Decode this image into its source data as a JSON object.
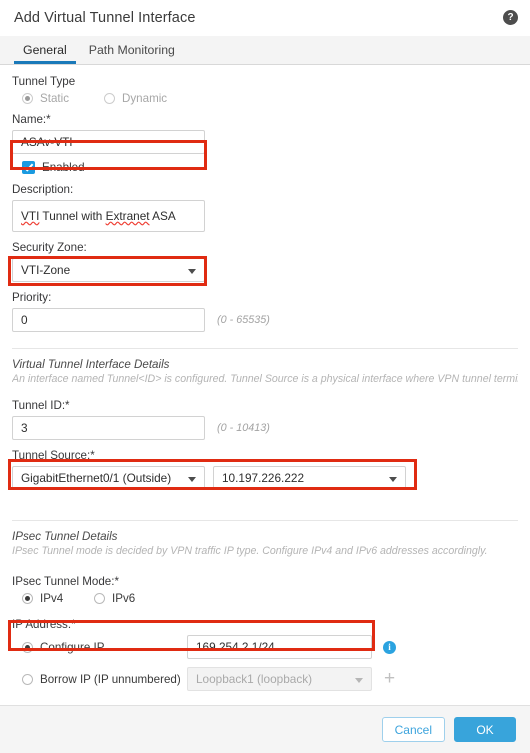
{
  "header": {
    "title": "Add Virtual Tunnel Interface",
    "help_icon": "help-icon"
  },
  "tabs": [
    {
      "label": "General",
      "active": true
    },
    {
      "label": "Path Monitoring",
      "active": false
    }
  ],
  "form": {
    "tunnel_type": {
      "label": "Tunnel Type",
      "options": [
        {
          "label": "Static",
          "selected": true,
          "disabled": true
        },
        {
          "label": "Dynamic",
          "selected": false,
          "disabled": true
        }
      ]
    },
    "name": {
      "label": "Name:*",
      "value": "ASAv-VTI",
      "highlighted": true
    },
    "enabled": {
      "label": "Enabled",
      "checked": true
    },
    "description": {
      "label": "Description:",
      "value_part1": "VTI",
      "value_part2": " Tunnel with ",
      "value_part3": "Extranet",
      "value_part4": " ASA",
      "value": "VTI Tunnel with Extranet ASA"
    },
    "security_zone": {
      "label": "Security Zone:",
      "value": "VTI-Zone",
      "highlighted": true
    },
    "priority": {
      "label": "Priority:",
      "value": "0",
      "hint": "(0 - 65535)"
    }
  },
  "vti_section": {
    "title": "Virtual Tunnel Interface Details",
    "description": "An interface named Tunnel<ID> is configured. Tunnel Source is a physical interface where VPN tunnel terminates for the VTI.",
    "tunnel_id": {
      "label": "Tunnel ID:*",
      "value": "3",
      "hint": "(0 - 10413)"
    },
    "tunnel_source": {
      "label": "Tunnel Source:*",
      "interface": "GigabitEthernet0/1 (Outside)",
      "address": "10.197.226.222",
      "highlighted": true
    }
  },
  "ipsec_section": {
    "title": "IPsec Tunnel Details",
    "description": "IPsec Tunnel mode is decided by VPN traffic IP type. Configure IPv4 and IPv6 addresses accordingly.",
    "tunnel_mode": {
      "label": "IPsec Tunnel Mode:*",
      "options": [
        {
          "label": "IPv4",
          "selected": true
        },
        {
          "label": "IPv6",
          "selected": false
        }
      ]
    },
    "ip_address": {
      "label": "IP Address:*",
      "configure_ip": {
        "label": "Configure IP",
        "selected": true,
        "value": "169.254.2.1/24",
        "highlighted": true,
        "info_icon": "info-icon"
      },
      "borrow_ip": {
        "label": "Borrow IP (IP unnumbered)",
        "selected": false,
        "value": "Loopback1 (loopback)",
        "disabled": true,
        "add_icon": "plus-icon"
      }
    }
  },
  "footer": {
    "cancel_label": "Cancel",
    "ok_label": "OK"
  },
  "colors": {
    "accent": "#38a4db",
    "highlight": "#e02b12",
    "tab_active": "#1a79b9",
    "checkbox": "#1a9ae0",
    "info": "#2ba3e0"
  }
}
